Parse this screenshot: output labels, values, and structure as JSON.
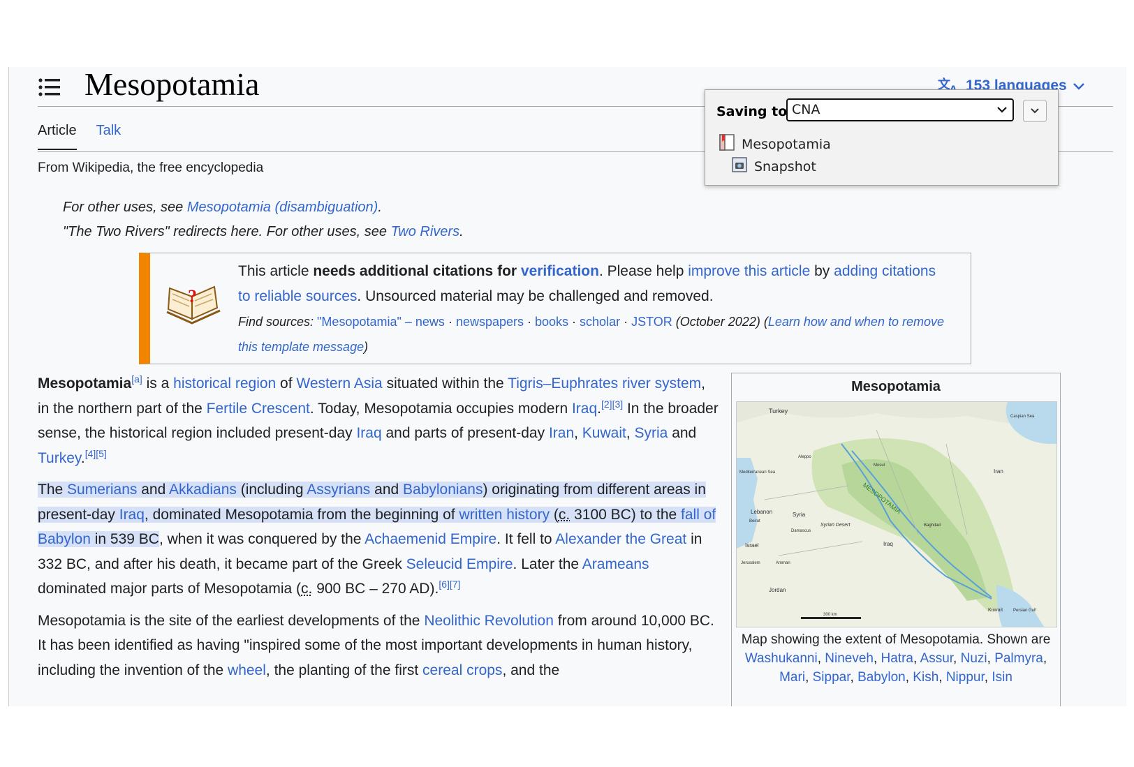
{
  "page": {
    "title": "Mesopotamia",
    "languages_label": "153 languages",
    "tabs": [
      {
        "label": "Article"
      },
      {
        "label": "Talk"
      }
    ],
    "tagline": "From Wikipedia, the free encyclopedia"
  },
  "hatnotes": {
    "line1_prefix": "For other uses, see ",
    "line1_link": "Mesopotamia (disambiguation)",
    "line1_suffix": ".",
    "line2_prefix": "\"The Two Rivers\" redirects here. For other uses, see ",
    "line2_link": "Two Rivers",
    "line2_suffix": "."
  },
  "ambox": {
    "t1": "This article ",
    "t2": "needs additional citations for ",
    "t3": "verification",
    "t4": ". Please help ",
    "t5": "improve this article",
    "t6": " by ",
    "t7": "adding citations to reliable sources",
    "t8": ". Unsourced material may be challenged and removed.",
    "find_label": "Find sources: ",
    "find_query": "\"Mesopotamia\"",
    "find_dash": " – ",
    "news": "news",
    "newspapers": "newspapers",
    "books": "books",
    "scholar": "scholar",
    "jstor": "JSTOR",
    "sep": " · ",
    "date": " (October 2022) (",
    "learn": "Learn how and when to remove this template message",
    "close": ")"
  },
  "para1": {
    "bold": "Mesopotamia",
    "ref_a": "[a]",
    "t1": " is a ",
    "l1": "historical region",
    "t2": " of ",
    "l2": "Western Asia",
    "t3": " situated within the ",
    "l3": "Tigris–Euphrates river system",
    "t4": ", in the northern part of the ",
    "l4": "Fertile Crescent",
    "t5": ". Today, Mesopotamia occupies modern ",
    "l5": "Iraq",
    "t6": ".",
    "ref_23": "[2][3]",
    "t7": " In the broader sense, the historical region included present-day ",
    "l6": "Iraq",
    "t8": " and parts of present-day ",
    "l7": "Iran",
    "t9": ", ",
    "l8": "Kuwait",
    "t10": ", ",
    "l9": "Syria",
    "t11": " and ",
    "l10": "Turkey",
    "t12": ".",
    "ref_45": "[4][5]"
  },
  "para2": {
    "t1": "The ",
    "l1": "Sumerians",
    "t2": " and ",
    "l2": "Akkadians",
    "t3": " (including ",
    "l3": "Assyrians",
    "t4": " and ",
    "l4": "Babylonians",
    "t5": ") originating from different areas in present-day ",
    "l5": "Iraq",
    "t6": ", dominated Mesopotamia from the beginning of ",
    "l6": "written history",
    "t7": " (",
    "abbr": "c.",
    "t8": " 3100 BC) to the ",
    "l7": "fall of Babylon",
    "t9": " in 539 BC",
    "t10": ", when it was conquered by the ",
    "l8": "Achaemenid Empire",
    "t11": ". It fell to ",
    "l9": "Alexander the Great",
    "t12": " in 332 BC, and after his death, it became part of the Greek ",
    "l10": "Seleucid Empire",
    "t13": ". Later the ",
    "l11": "Arameans",
    "t14": " dominated major parts of Mesopotamia (",
    "abbr2": "c.",
    "t15": " 900 BC – 270 AD).",
    "ref_67": "[6][7]"
  },
  "para3": {
    "t1": "Mesopotamia is the site of the earliest developments of the ",
    "l1": "Neolithic Revolution",
    "t2": " from around 10,000 BC. It has been identified as having \"inspired some of the most important developments in human history, including the invention of the ",
    "l2": "wheel",
    "t3": ", the planting of the first ",
    "l3": "cereal crops",
    "t4": ", and the"
  },
  "infobox": {
    "title": "Mesopotamia",
    "map_labels": {
      "turkey": "Turkey",
      "caspian": "Caspian Sea",
      "mediterranean": "Mediterranean Sea",
      "lebanon": "Lebanon",
      "beirut": "Beirut",
      "syria": "Syria",
      "damascus": "Damascus",
      "syrian_desert": "Syrian Desert",
      "israel": "Israel",
      "jerusalem": "Jerusalem",
      "amman": "Amman",
      "jordan": "Jordan",
      "iraq": "Iraq",
      "iran": "Iran",
      "mesopotamia": "MESOPOTAMIA",
      "kuwait": "Kuwait",
      "persian_gulf": "Persian Gulf",
      "aleppo": "Aleppo",
      "mosul": "Mosul",
      "baghdad": "Baghdad",
      "scale": "300 km"
    },
    "caption_t1": "Map showing the extent of Mesopotamia. Shown are ",
    "c1": "Washukanni",
    "c2": "Nineveh",
    "c3": "Hatra",
    "c4": "Assur",
    "c5": "Nuzi",
    "c6": "Palmyra",
    "c7": "Mari",
    "c8": "Sippar",
    "c9": "Babylon",
    "c10": "Kish",
    "c11": "Nippur",
    "c12": "Isin",
    "comma": ", "
  },
  "popup": {
    "label": "Saving to",
    "collection": "CNA",
    "item_title": "Mesopotamia",
    "attachment": "Snapshot"
  },
  "colors": {
    "link": "#3366cc",
    "ambox_border": "#f28500",
    "highlight": "#d6e1f7"
  }
}
